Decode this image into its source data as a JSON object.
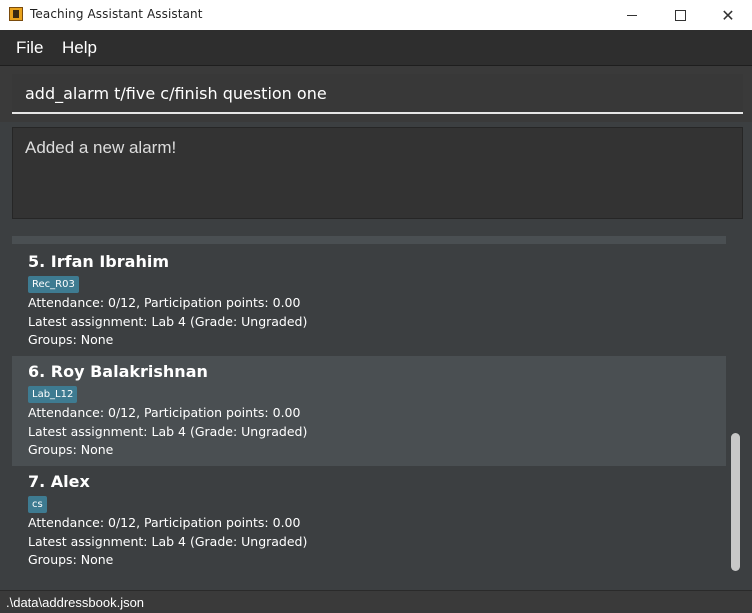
{
  "window": {
    "title": "Teaching Assistant Assistant",
    "icon": "app-icon"
  },
  "menu": {
    "items": [
      "File",
      "Help"
    ]
  },
  "command": {
    "value": "add_alarm t/five c/finish question one"
  },
  "result": {
    "text": "Added a new alarm!"
  },
  "persons": [
    {
      "name": "5.  Irfan Ibrahim",
      "tag": "Rec_R03",
      "attendance": "Attendance: 0/12, Participation points: 0.00",
      "assignment": "Latest assignment: Lab 4 (Grade: Ungraded)",
      "groups": "Groups: None",
      "selected": false
    },
    {
      "name": "6.  Roy Balakrishnan",
      "tag": "Lab_L12",
      "attendance": "Attendance: 0/12, Participation points: 0.00",
      "assignment": "Latest assignment: Lab 4 (Grade: Ungraded)",
      "groups": "Groups: None",
      "selected": true
    },
    {
      "name": "7.  Alex",
      "tag": "cs",
      "attendance": "Attendance: 0/12, Participation points: 0.00",
      "assignment": "Latest assignment: Lab 4 (Grade: Ungraded)",
      "groups": "Groups: None",
      "selected": false
    }
  ],
  "status": {
    "path": ".\\data\\addressbook.json"
  },
  "colors": {
    "background": "#3c3f41",
    "selected_card": "#4a4f52",
    "tag": "#3e7b91"
  }
}
